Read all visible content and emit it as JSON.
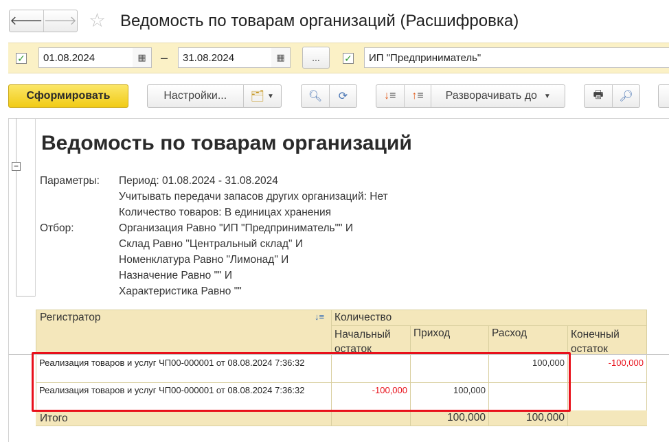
{
  "window": {
    "title": "Ведомость по товарам организаций (Расшифровка)",
    "icons": {
      "back": "arrow-left",
      "forward": "arrow-right",
      "favorite": "star-outline"
    }
  },
  "filters": {
    "period_enabled": true,
    "date_from": "01.08.2024",
    "date_separator": "–",
    "date_to": "31.08.2024",
    "period_button_label": "...",
    "organization_enabled": true,
    "organization": "ИП \"Предприниматель\""
  },
  "toolbar": {
    "generate_label": "Сформировать",
    "settings_label": "Настройки...",
    "expand_to_label": "Разворачивать до"
  },
  "report": {
    "title": "Ведомость по товарам организаций",
    "params_label": "Параметры:",
    "params": [
      "Период: 01.08.2024 - 31.08.2024",
      "Учитывать передачи запасов других организаций: Нет",
      "Количество товаров: В единицах хранения"
    ],
    "filter_label": "Отбор:",
    "filter": [
      "Организация Равно \"ИП \"Предприниматель\"\" И",
      "Склад Равно \"Центральный склад\" И",
      "Номенклатура Равно \"Лимонад\" И",
      "Назначение Равно \"\" И",
      "Характеристика Равно \"\""
    ]
  },
  "table": {
    "col_registrar": "Регистратор",
    "col_quantity": "Количество",
    "col_opening": "Начальный остаток",
    "col_income": "Приход",
    "col_expense": "Расход",
    "col_closing": "Конечный остаток",
    "rows": [
      {
        "registrar": "Реализация товаров и услуг ЧП00-000001 от 08.08.2024 7:36:32",
        "opening": "",
        "income": "",
        "expense": "100,000",
        "closing": "-100,000"
      },
      {
        "registrar": "Реализация товаров и услуг ЧП00-000001 от 08.08.2024 7:36:32",
        "opening": "-100,000",
        "income": "100,000",
        "expense": "",
        "closing": ""
      }
    ],
    "total": {
      "label": "Итого",
      "opening": "",
      "income": "100,000",
      "expense": "100,000",
      "closing": ""
    }
  },
  "colors": {
    "primary_button": "#f1cb16",
    "filter_panel": "#fbf1c6",
    "table_header": "#f4e7bb",
    "negative": "#e8101a",
    "highlight_frame": "#e8101a"
  }
}
